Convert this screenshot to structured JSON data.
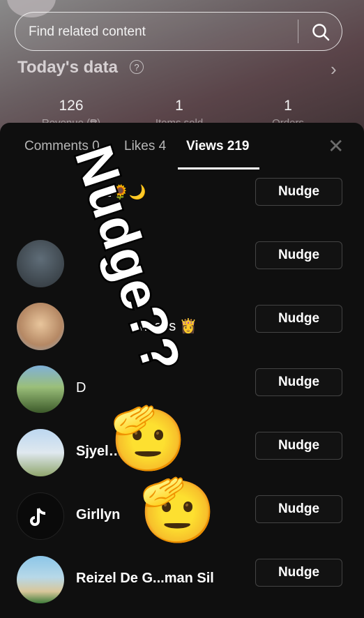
{
  "search": {
    "placeholder": "Find related content"
  },
  "today": {
    "title": "Today's data",
    "help": "?",
    "chevron": "›"
  },
  "stats": [
    {
      "value": "126",
      "label": "Revenue (₱)"
    },
    {
      "value": "1",
      "label": "Items sold"
    },
    {
      "value": "1",
      "label": "Orders"
    }
  ],
  "tabs": [
    {
      "label": "Comments 0"
    },
    {
      "label": "Likes 4"
    },
    {
      "label": "Views 219"
    }
  ],
  "close_glyph": "✕",
  "nudge_label": "Nudge",
  "rows": [
    {
      "name": "z🌻🌙"
    },
    {
      "name": ""
    },
    {
      "name": "ncess 👸"
    },
    {
      "name": "D"
    },
    {
      "name": "Sjyel… ’TER..."
    },
    {
      "name": "Girllyn"
    },
    {
      "name": "Reizel De G...man Sil"
    }
  ],
  "sticker": {
    "text": "Nudge??",
    "emoji": "🫡"
  }
}
